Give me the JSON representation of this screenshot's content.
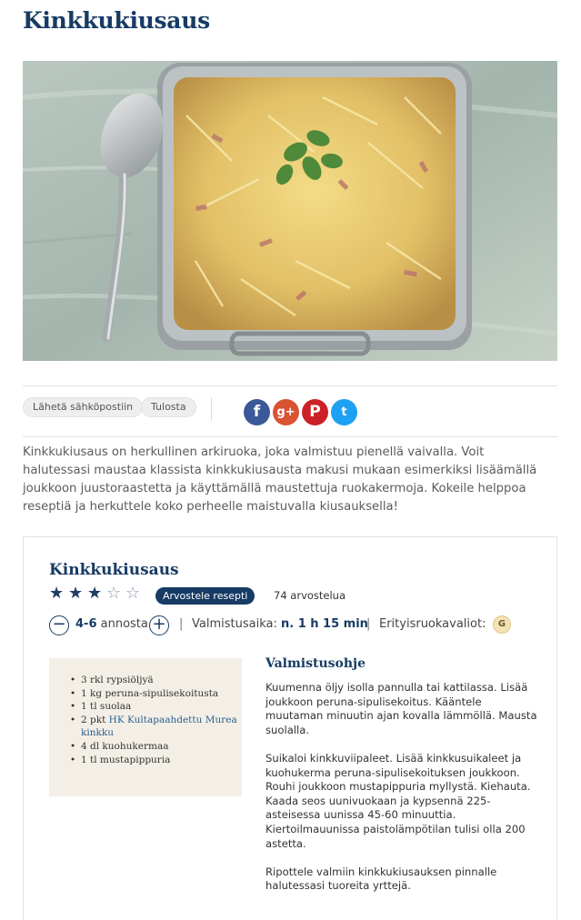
{
  "page": {
    "title": "Kinkkukiusaus"
  },
  "hero": {
    "alt": "Kinkkukiusaus uunivuoassa, vieressä lusikka"
  },
  "share": {
    "email_label": "Lähetä sähköpostiin",
    "print_label": "Tulosta",
    "facebook": "f",
    "googleplus": "g+",
    "pinterest": "P",
    "twitter": "t"
  },
  "intro": "Kinkkukiusaus on herkullinen arkiruoka, joka valmistuu pienellä vaivalla. Voit halutessasi maustaa klassista kinkkukiusausta makusi mukaan esimerkiksi lisäämällä joukkoon juustoraastetta ja käyttämällä maustettuja ruokakermoja. Kokeile helppoa reseptiä ja herkuttele koko perheelle maistuvalla kiusauksella!",
  "recipe": {
    "title": "Kinkkukiusaus",
    "rating": 3,
    "max_rating": 5,
    "rate_button": "Arvostele resepti",
    "review_count": "74 arvostelua",
    "servings_value": "4-6",
    "servings_unit": "annosta",
    "time_label": "Valmistusaika:",
    "time_value": "n. 1 h 15 min",
    "diet_label": "Erityisruokavaliot:",
    "diet_badge": "G",
    "ingredients": [
      {
        "text": "3 rkl rypsiöljyä"
      },
      {
        "text": "1 kg peruna-sipulisekoitusta"
      },
      {
        "text": "1 tl suolaa"
      },
      {
        "prefix": "2 pkt ",
        "link": "HK Kultapaahdettu Murea kinkku"
      },
      {
        "text": "4 dl kuohukermaa"
      },
      {
        "text": "1 tl mustapippuria"
      }
    ],
    "instructions_title": "Valmistusohje",
    "instructions": [
      "Kuumenna öljy isolla pannulla tai kattilassa. Lisää joukkoon peruna-sipulisekoitus. Kääntele muutaman minuutin ajan kovalla lämmöllä. Mausta suolalla.",
      "Suikaloi kinkkuviipaleet. Lisää kinkkusuikaleet ja kuohukerma peruna-sipulisekoituksen joukkoon. Rouhi joukkoon mustapippuria myllystä. Kiehauta. Kaada seos uunivuokaan ja kypsennä 225-asteisessa uunissa 45-60 minuuttia. Kiertoilmauunissa paistolämpötilan tulisi olla 200 astetta.",
      "Ripottele valmiin kinkkukiusauksen pinnalle halutessasi tuoreita yrttejä."
    ]
  }
}
